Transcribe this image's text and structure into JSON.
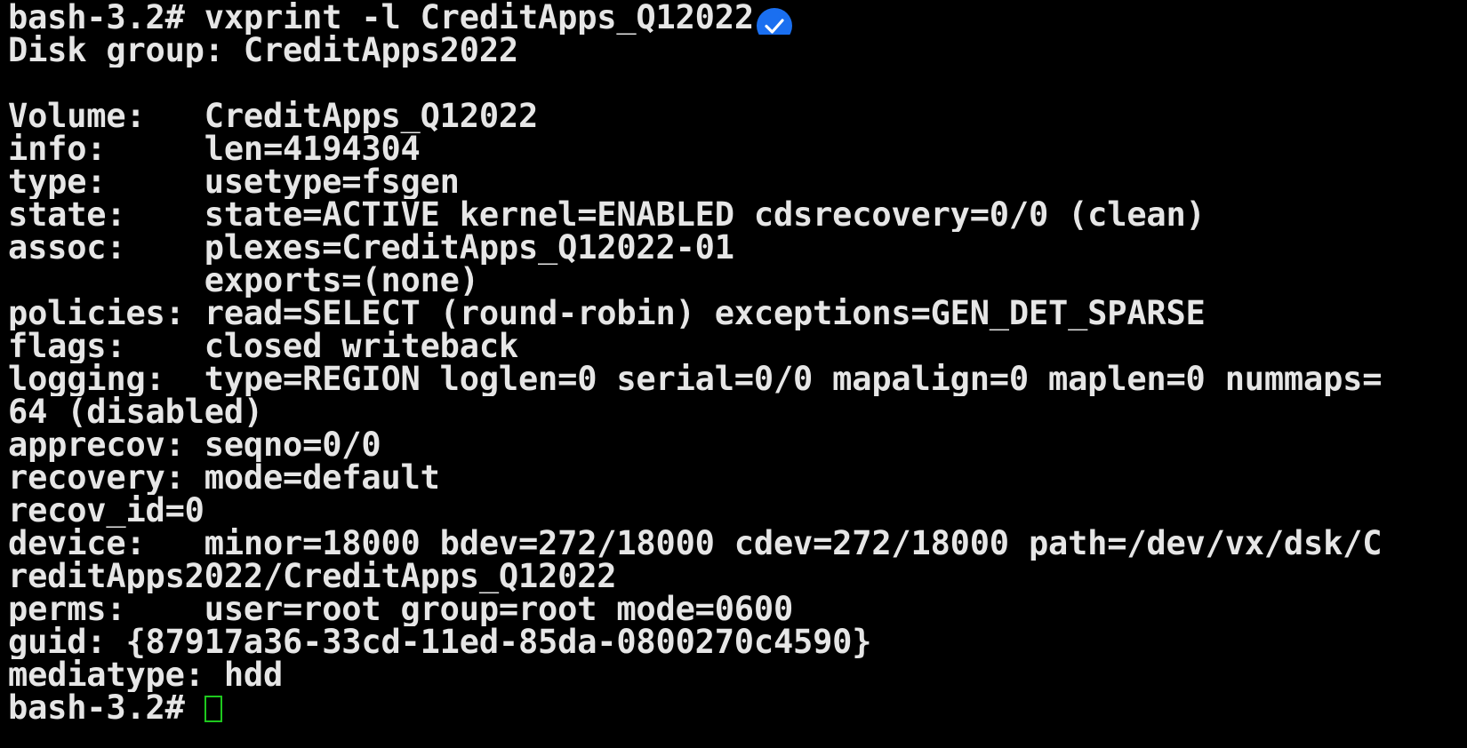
{
  "terminal": {
    "prompt": "bash-3.2# ",
    "command": "vxprint -l CreditApps_Q12022",
    "colors": {
      "background": "#000000",
      "text": "#e6e6e6",
      "cursor": "#1ec81e",
      "verified_badge": "#1a6ff0"
    },
    "badge_icon": "verified-check-icon",
    "output": [
      "Disk group: CreditApps2022",
      "",
      "Volume:   CreditApps_Q12022",
      "info:     len=4194304",
      "type:     usetype=fsgen",
      "state:    state=ACTIVE kernel=ENABLED cdsrecovery=0/0 (clean)",
      "assoc:    plexes=CreditApps_Q12022-01",
      "          exports=(none)",
      "policies: read=SELECT (round-robin) exceptions=GEN_DET_SPARSE",
      "flags:    closed writeback",
      "logging:  type=REGION loglen=0 serial=0/0 mapalign=0 maplen=0 nummaps=",
      "64 (disabled)",
      "apprecov: seqno=0/0",
      "recovery: mode=default",
      "recov_id=0",
      "device:   minor=18000 bdev=272/18000 cdev=272/18000 path=/dev/vx/dsk/C",
      "reditApps2022/CreditApps_Q12022",
      "perms:    user=root group=root mode=0600",
      "guid: {87917a36-33cd-11ed-85da-0800270c4590}",
      "mediatype: hdd"
    ],
    "final_prompt": "bash-3.2# "
  }
}
